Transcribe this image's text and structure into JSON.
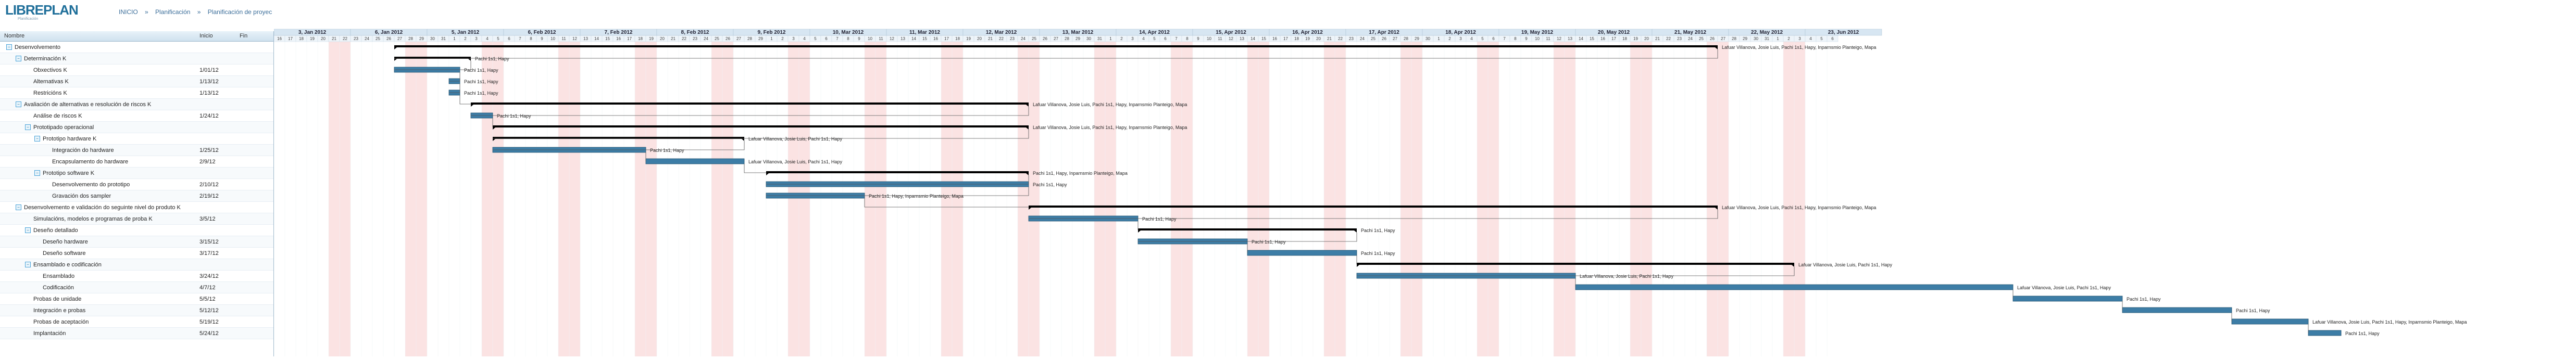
{
  "logo": {
    "text": "LIBREPLAN",
    "subtitle": "Planificación"
  },
  "breadcrumb": {
    "start": "INICIO",
    "sep1": "»",
    "planning": "Planificación",
    "sep2": "»",
    "project": "Planificación de proyec"
  },
  "columns": {
    "name": "Nombre",
    "start": "Inicio",
    "end": "Fin"
  },
  "tasks": [
    {
      "name": "Desenvolvemento",
      "start": "",
      "end": "",
      "level": 0,
      "group": true
    },
    {
      "name": "Determinación K",
      "start": "",
      "end": "",
      "level": 1,
      "group": true
    },
    {
      "name": "Obxectivos K",
      "start": "1/01/12",
      "end": "",
      "level": 2,
      "group": false
    },
    {
      "name": "Alternativas K",
      "start": "1/13/12",
      "end": "",
      "level": 2,
      "group": false
    },
    {
      "name": "Restricións K",
      "start": "1/13/12",
      "end": "",
      "level": 2,
      "group": false
    },
    {
      "name": "Avaliación de alternativas e resolución de riscos K",
      "start": "",
      "end": "",
      "level": 1,
      "group": true
    },
    {
      "name": "Análise de riscos K",
      "start": "1/24/12",
      "end": "",
      "level": 2,
      "group": false
    },
    {
      "name": "Prototipado operacional",
      "start": "",
      "end": "",
      "level": 2,
      "group": true
    },
    {
      "name": "Prototipo hardware K",
      "start": "",
      "end": "",
      "level": 3,
      "group": true
    },
    {
      "name": "Integración do hardware",
      "start": "1/25/12",
      "end": "",
      "level": 4,
      "group": false
    },
    {
      "name": "Encapsulamento do hardware",
      "start": "2/9/12",
      "end": "",
      "level": 4,
      "group": false
    },
    {
      "name": "Prototipo software K",
      "start": "",
      "end": "",
      "level": 3,
      "group": true
    },
    {
      "name": "Desenvolvemento do prototipo",
      "start": "2/10/12",
      "end": "",
      "level": 4,
      "group": false
    },
    {
      "name": "Gravación dos sampler",
      "start": "2/19/12",
      "end": "",
      "level": 4,
      "group": false
    },
    {
      "name": "Desenvolvemento e validación do seguinte nivel do produto K",
      "start": "",
      "end": "",
      "level": 1,
      "group": true
    },
    {
      "name": "Simulacións, modelos e programas de proba K",
      "start": "3/5/12",
      "end": "",
      "level": 2,
      "group": false
    },
    {
      "name": "Deseño detallado",
      "start": "",
      "end": "",
      "level": 2,
      "group": true
    },
    {
      "name": "Deseño hardware",
      "start": "3/15/12",
      "end": "",
      "level": 3,
      "group": false
    },
    {
      "name": "Deseño software",
      "start": "3/17/12",
      "end": "",
      "level": 3,
      "group": false
    },
    {
      "name": "Ensamblado e codificación",
      "start": "",
      "end": "",
      "level": 2,
      "group": true
    },
    {
      "name": "Ensamblado",
      "start": "3/24/12",
      "end": "",
      "level": 3,
      "group": false
    },
    {
      "name": "Codificación",
      "start": "4/7/12",
      "end": "",
      "level": 3,
      "group": false
    },
    {
      "name": "Probas de unidade",
      "start": "5/5/12",
      "end": "",
      "level": 2,
      "group": false
    },
    {
      "name": "Integración e probas",
      "start": "5/12/12",
      "end": "",
      "level": 2,
      "group": false
    },
    {
      "name": "Probas de aceptación",
      "start": "5/19/12",
      "end": "",
      "level": 2,
      "group": false
    },
    {
      "name": "Implantación",
      "start": "5/24/12",
      "end": "",
      "level": 2,
      "group": false
    }
  ],
  "weeks": [
    "3, Jan 2012",
    "6, Jan 2012",
    "5, Jan 2012",
    "6, Feb 2012",
    "7, Feb 2012",
    "8, Feb 2012",
    "9, Feb 2012",
    "10, Mar 2012",
    "11, Mar 2012",
    "12, Mar 2012",
    "13, Mar 2012",
    "14, Apr 2012",
    "15, Apr 2012",
    "16, Apr 2012",
    "17, Apr 2012",
    "18, Apr 2012",
    "19, May 2012",
    "20, May 2012",
    "21, May 2012",
    "22, May 2012",
    "23, Jun 2012"
  ],
  "days": [
    "16",
    "17",
    "18",
    "19",
    "20",
    "21",
    "22",
    "23",
    "24",
    "25",
    "26",
    "27",
    "28",
    "29",
    "30",
    "31",
    "1",
    "2",
    "3",
    "4",
    "5",
    "6",
    "7",
    "8",
    "9",
    "10",
    "11",
    "12",
    "13",
    "14",
    "15",
    "16",
    "17",
    "18",
    "19",
    "20",
    "21",
    "22",
    "23",
    "24",
    "25",
    "26",
    "27",
    "28",
    "29",
    "1",
    "2",
    "3",
    "4",
    "5",
    "6",
    "7",
    "8",
    "9",
    "10",
    "11",
    "12",
    "13",
    "14",
    "15",
    "16",
    "17",
    "18",
    "19",
    "20",
    "21",
    "22",
    "23",
    "24",
    "25",
    "26",
    "27",
    "28",
    "29",
    "30",
    "31",
    "1",
    "2",
    "3",
    "4",
    "5",
    "6",
    "7",
    "8",
    "9",
    "10",
    "11",
    "12",
    "13",
    "14",
    "15",
    "16",
    "17",
    "18",
    "19",
    "20",
    "21",
    "22",
    "23",
    "24",
    "25",
    "26",
    "27",
    "28",
    "29",
    "30",
    "1",
    "2",
    "3",
    "4",
    "5",
    "6",
    "7",
    "8",
    "9",
    "10",
    "11",
    "12",
    "13",
    "14",
    "15",
    "16",
    "17",
    "18",
    "19",
    "20",
    "21",
    "22",
    "23",
    "24",
    "25",
    "26",
    "27",
    "28",
    "29",
    "30",
    "31",
    "1",
    "2",
    "3",
    "4",
    "5",
    "6"
  ],
  "bars": [
    {
      "row": 0,
      "start": "2012-01-27",
      "end": "2012-05-27",
      "type": "group",
      "label": "Lafuar Villanova, Josie Luis, Pachi 1s1, Hapy, Inparnsmio Planteigo, Mapa"
    },
    {
      "row": 1,
      "start": "2012-01-27",
      "end": "2012-02-03",
      "type": "group",
      "label": "Pachi 1s1, Hapy"
    },
    {
      "row": 2,
      "start": "2012-01-27",
      "end": "2012-02-02",
      "type": "task",
      "label": "Pachi 1s1, Hapy"
    },
    {
      "row": 3,
      "start": "2012-02-01",
      "end": "2012-02-02",
      "type": "task",
      "label": "Pachi 1s1, Hapy"
    },
    {
      "row": 4,
      "start": "2012-02-01",
      "end": "2012-02-02",
      "type": "task",
      "label": "Pachi 1s1, Hapy"
    },
    {
      "row": 5,
      "start": "2012-02-03",
      "end": "2012-03-25",
      "type": "group",
      "label": "Lafuar Villanova, Josie Luis, Pachi 1s1, Hapy, Inparnsmio Planteigo, Mapa"
    },
    {
      "row": 6,
      "start": "2012-02-03",
      "end": "2012-02-05",
      "type": "task",
      "label": "Pachi 1s1, Hapy"
    },
    {
      "row": 7,
      "start": "2012-02-05",
      "end": "2012-03-25",
      "type": "group",
      "label": "Lafuar Villanova, Josie Luis, Pachi 1s1, Hapy, Inparnsmio Planteigo, Mapa"
    },
    {
      "row": 8,
      "start": "2012-02-05",
      "end": "2012-02-28",
      "type": "group",
      "label": "Lafuar Villanova, Josie Luis, Pachi 1s1, Hapy"
    },
    {
      "row": 9,
      "start": "2012-02-05",
      "end": "2012-02-19",
      "type": "task",
      "label": "Pachi 1s1, Hapy"
    },
    {
      "row": 10,
      "start": "2012-02-19",
      "end": "2012-02-28",
      "type": "task",
      "label": "Lafuar Villanova, Josie Luis, Pachi 1s1, Hapy"
    },
    {
      "row": 11,
      "start": "2012-03-01",
      "end": "2012-03-25",
      "type": "group",
      "label": "Pachi 1s1, Hapy, Inparnsmio Planteigo, Mapa"
    },
    {
      "row": 12,
      "start": "2012-03-01",
      "end": "2012-03-25",
      "type": "task",
      "label": "Pachi 1s1, Hapy"
    },
    {
      "row": 13,
      "start": "2012-03-01",
      "end": "2012-03-10",
      "type": "task",
      "label": "Pachi 1s1, Hapy, Inparnsmio Planteigo, Mapa"
    },
    {
      "row": 14,
      "start": "2012-03-25",
      "end": "2012-05-27",
      "type": "group",
      "label": "Lafuar Villanova, Josie Luis, Pachi 1s1, Hapy, Inparnsmio Planteigo, Mapa"
    },
    {
      "row": 15,
      "start": "2012-03-25",
      "end": "2012-04-04",
      "type": "task",
      "label": "Pachi 1s1, Hapy"
    },
    {
      "row": 16,
      "start": "2012-04-04",
      "end": "2012-04-24",
      "type": "group",
      "label": "Pachi 1s1, Hapy"
    },
    {
      "row": 17,
      "start": "2012-04-04",
      "end": "2012-04-14",
      "type": "task",
      "label": "Pachi 1s1, Hapy"
    },
    {
      "row": 18,
      "start": "2012-04-14",
      "end": "2012-04-24",
      "type": "task",
      "label": "Pachi 1s1, Hapy"
    },
    {
      "row": 19,
      "start": "2012-04-24",
      "end": "2012-06-03",
      "type": "group",
      "label": "Lafuar Villanova, Josie Luis, Pachi 1s1, Hapy"
    },
    {
      "row": 20,
      "start": "2012-04-24",
      "end": "2012-05-14",
      "type": "task",
      "label": "Lafuar Villanova, Josie Luis, Pachi 1s1, Hapy"
    },
    {
      "row": 21,
      "start": "2012-05-14",
      "end": "2012-06-23",
      "type": "task",
      "label": "Lafuar Villanova, Josie Luis, Pachi 1s1, Hapy"
    },
    {
      "row": 22,
      "start": "2012-06-23",
      "end": "2012-07-03",
      "type": "task",
      "label": "Pachi 1s1, Hapy"
    },
    {
      "row": 23,
      "start": "2012-07-03",
      "end": "2012-07-13",
      "type": "task",
      "label": "Pachi 1s1, Hapy"
    },
    {
      "row": 24,
      "start": "2012-07-13",
      "end": "2012-07-20",
      "type": "task",
      "label": "Lafuar Villanova, Josie Luis, Pachi 1s1, Hapy, Inparnsmio Planteigo, Mapa"
    },
    {
      "row": 25,
      "start": "2012-07-20",
      "end": "2012-07-23",
      "type": "task",
      "label": "Pachi 1s1, Hapy"
    }
  ],
  "colors": {
    "bar": "#3d7da6",
    "group": "#000000",
    "weekend": "#fbe3e3",
    "header": "#d7e6f2",
    "accent": "#1f6f9a"
  }
}
